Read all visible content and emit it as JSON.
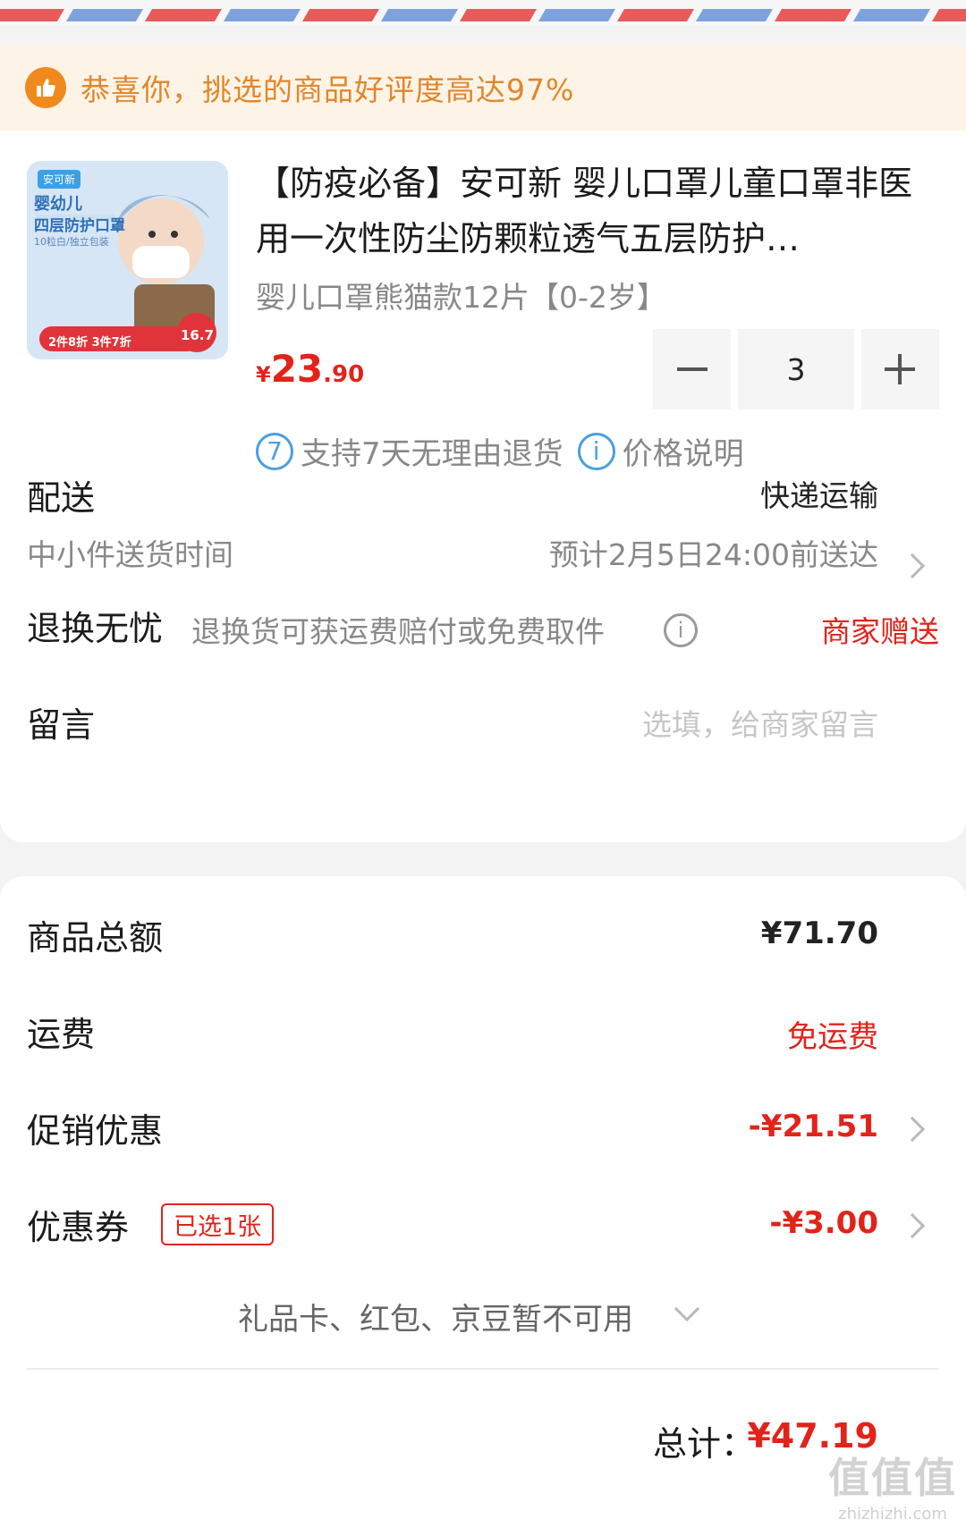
{
  "colors": {
    "red": "#e2231a",
    "orange": "#e2862a",
    "blue": "#4a9fe0"
  },
  "notice": {
    "text": "恭喜你，挑选的商品好评度高达97%",
    "icon": "thumbs-up-icon"
  },
  "product": {
    "title": "【防疫必备】安可新 婴儿口罩儿童口罩非医用一次性防尘防颗粒透气五层防护…",
    "spec": "婴儿口罩熊猫款12片【0-2岁】",
    "price_symbol": "¥",
    "price_int": "23",
    "price_dec": ".90",
    "quantity": "3",
    "image_text": {
      "brand": "安可新",
      "title_line1": "婴幼儿",
      "title_line2": "四层防护口罩",
      "small": "10粒白/独立包装",
      "promo": "2件8折 3件7折",
      "promo_price": "16.7"
    }
  },
  "service": {
    "return_icon_text": "7",
    "return_text": "支持7天无理由退货",
    "info_icon_text": "i",
    "price_text": "价格说明"
  },
  "delivery": {
    "label": "配送",
    "method": "快递运输",
    "sub_label": "中小件送货时间",
    "estimate": "预计2月5日24:00前送达"
  },
  "exchange": {
    "label": "退换无忧",
    "desc": "退换货可获运费赔付或免费取件",
    "info_icon_text": "i",
    "value": "商家赠送"
  },
  "message": {
    "label": "留言",
    "placeholder": "选填，给商家留言"
  },
  "summary": {
    "goods_total_label": "商品总额",
    "goods_total": "¥71.70",
    "shipping_label": "运费",
    "shipping": "免运费",
    "promo_label": "促销优惠",
    "promo": "-¥21.51",
    "coupon_label": "优惠券",
    "coupon_badge": "已选1张",
    "coupon": "-¥3.00",
    "unavailable": "礼品卡、红包、京豆暂不可用",
    "total_label": "总计：",
    "total": "¥47.19"
  },
  "watermark": {
    "big": "值值值",
    "small": "zhizhizhi.com"
  }
}
